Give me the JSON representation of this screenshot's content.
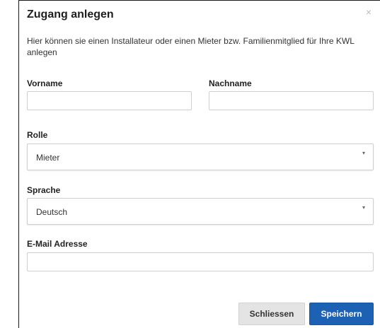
{
  "dialog": {
    "title": "Zugang anlegen",
    "close_glyph": "×",
    "description": "Hier können sie einen Installateur oder einen Mieter bzw. Familienmitglied für Ihre KWL anlegen"
  },
  "form": {
    "vorname": {
      "label": "Vorname",
      "value": ""
    },
    "nachname": {
      "label": "Nachname",
      "value": ""
    },
    "rolle": {
      "label": "Rolle",
      "selected": "Mieter"
    },
    "sprache": {
      "label": "Sprache",
      "selected": "Deutsch"
    },
    "email": {
      "label": "E-Mail Adresse",
      "value": ""
    },
    "caret_glyph": "▾"
  },
  "footer": {
    "close_label": "Schliessen",
    "save_label": "Speichern"
  },
  "colors": {
    "primary": "#1d61b5",
    "secondary_button": "#e4e4e4"
  }
}
